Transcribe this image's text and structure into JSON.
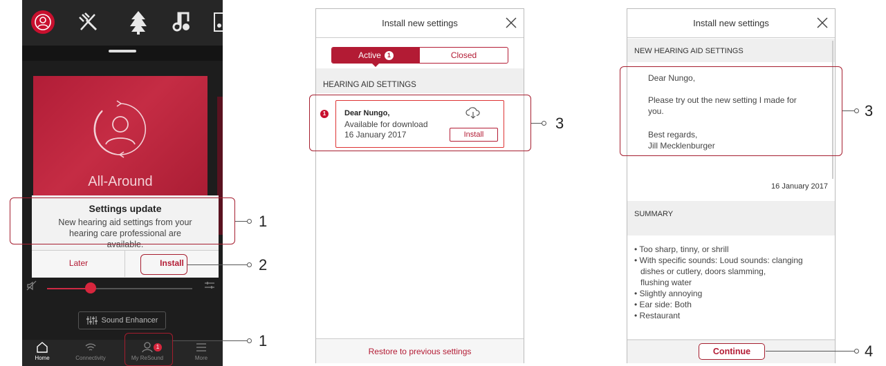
{
  "phone": {
    "card_title": "All-Around",
    "dialog": {
      "title": "Settings update",
      "message_line1": "New hearing aid settings from your",
      "message_line2": "hearing care professional are available.",
      "later_label": "Later",
      "install_label": "Install"
    },
    "sound_enhancer_label": "Sound Enhancer",
    "volume_level": 0.3,
    "nav": {
      "home": "Home",
      "connectivity": "Connectivity",
      "myresound": "My ReSound",
      "more": "More",
      "badge": "1"
    }
  },
  "install_list": {
    "title": "Install new settings",
    "tab_active": "Active",
    "tab_active_count": "1",
    "tab_closed": "Closed",
    "section_title": "HEARING AID SETTINGS",
    "item": {
      "badge": "1",
      "name": "Dear Nungo,",
      "status": "Available for download",
      "date": "16 January 2017",
      "install_label": "Install"
    },
    "footer_label": "Restore to previous settings"
  },
  "install_detail": {
    "title": "Install new settings",
    "section_title": "NEW HEARING AID SETTINGS",
    "greeting": "Dear Nungo,",
    "body_line1": "Please try out the new setting I made for",
    "body_line2": "you.",
    "closing": "Best regards,",
    "signature": "Jill Mecklenburger",
    "date": "16 January 2017",
    "summary_title": "SUMMARY",
    "summary_items": [
      "Too sharp, tinny, or shrill",
      "With specific sounds: Loud sounds: clanging",
      "dishes or cutlery, doors slamming,",
      "flushing water",
      "Slightly annoying",
      "Ear side: Both",
      "Restaurant"
    ],
    "continue_label": "Continue"
  },
  "callouts": {
    "c1": "1",
    "c2": "2",
    "c3": "1",
    "c4": "3",
    "c5": "3",
    "c6": "4"
  }
}
